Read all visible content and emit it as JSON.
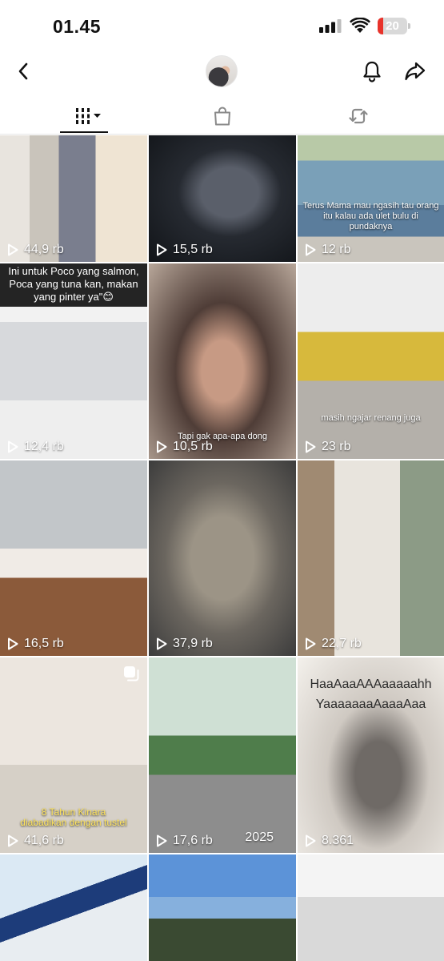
{
  "status_bar": {
    "time": "01.45",
    "battery": "20",
    "battery_level": 0.2,
    "battery_color": "#e8332b"
  },
  "header": {
    "back_icon": "chevron-left-icon",
    "bell_icon": "bell-icon",
    "share_icon": "share-arrow-icon"
  },
  "tabs": [
    {
      "icon": "videos-grid-icon",
      "active": true
    },
    {
      "icon": "shopping-bag-icon",
      "active": false
    },
    {
      "icon": "repost-icon",
      "active": false
    }
  ],
  "grid": {
    "tiles": [
      {
        "views": "44,9 rb"
      },
      {
        "views": "15,5 rb"
      },
      {
        "views": "12 rb",
        "caption": "Terus Mama mau ngasih tau orang itu kalau ada ulet bulu di pundaknya"
      },
      {
        "views": "12,4 rb",
        "caption_top": "Ini untuk Poco yang salmon, Poca yang tuna kan, makan yang pinter ya\"😊"
      },
      {
        "views": "10,5 rb",
        "caption": "Tapi gak apa-apa dong"
      },
      {
        "views": "23 rb",
        "caption": "masih ngajar renang juga"
      },
      {
        "views": "16,5 rb"
      },
      {
        "views": "37,9 rb"
      },
      {
        "views": "22,7 rb"
      },
      {
        "views": "41,6 rb",
        "caption_line1": "8 Tahun Kinara",
        "caption_line2": "diabadikan dengan tustel"
      },
      {
        "views": "17,6 rb",
        "year": "2025"
      },
      {
        "views": "8.361",
        "meme_line1": "HaaAaaAAAaaaaahh",
        "meme_line2": "YaaaaaaaAaaaAaa"
      },
      {},
      {},
      {}
    ]
  }
}
